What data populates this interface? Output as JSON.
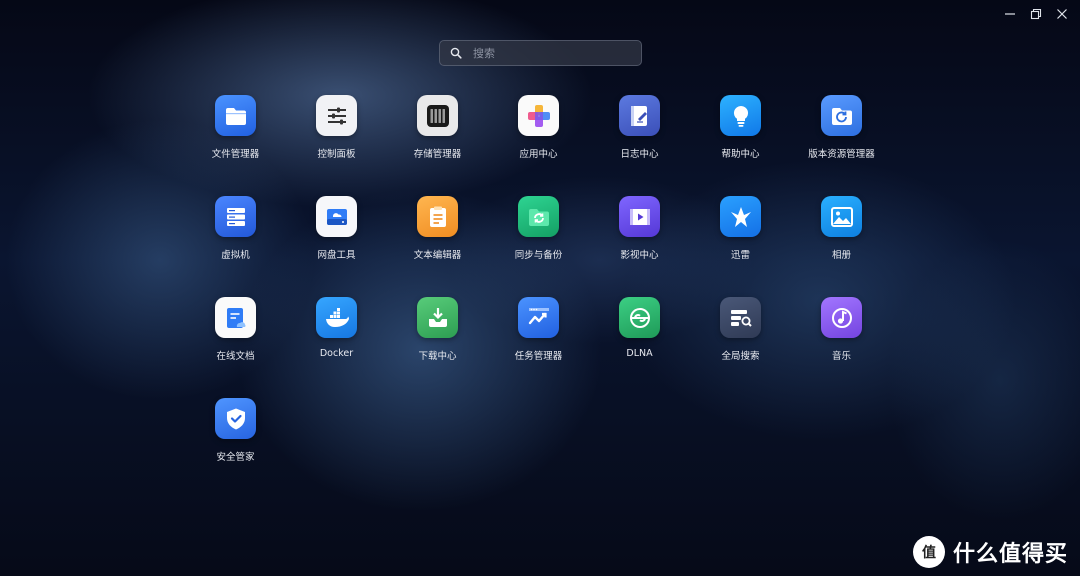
{
  "window": {
    "controls": [
      {
        "name": "minimize-icon"
      },
      {
        "name": "restore-icon"
      },
      {
        "name": "close-icon"
      }
    ]
  },
  "search": {
    "placeholder": "搜索",
    "icon": "search-icon"
  },
  "apps": [
    {
      "label": "文件管理器",
      "icon": "folder-icon",
      "color": "#2f7cf6"
    },
    {
      "label": "控制面板",
      "icon": "sliders-icon",
      "color": "#f2f2f4"
    },
    {
      "label": "存储管理器",
      "icon": "storage-icon",
      "color": "#ececec"
    },
    {
      "label": "应用中心",
      "icon": "apps-icon",
      "color": "#fafafa"
    },
    {
      "label": "日志中心",
      "icon": "log-icon",
      "color": "#4a63c8"
    },
    {
      "label": "帮助中心",
      "icon": "lightbulb-icon",
      "color": "#1a9bf2"
    },
    {
      "label": "版本资源管理器",
      "icon": "version-folder-icon",
      "color": "#3a86ef"
    },
    {
      "label": "虚拟机",
      "icon": "server-icon",
      "color": "#2e6ff0"
    },
    {
      "label": "网盘工具",
      "icon": "cloud-drive-icon",
      "color": "#f7f8fb"
    },
    {
      "label": "文本编辑器",
      "icon": "clipboard-icon",
      "color": "#f5a340"
    },
    {
      "label": "同步与备份",
      "icon": "sync-folder-icon",
      "color": "#1fb87a"
    },
    {
      "label": "影视中心",
      "icon": "video-icon",
      "color": "#6a4ef0"
    },
    {
      "label": "迅雷",
      "icon": "thunder-bird-icon",
      "color": "#1f88f2"
    },
    {
      "label": "相册",
      "icon": "photo-icon",
      "color": "#1898ee"
    },
    {
      "label": "在线文档",
      "icon": "online-doc-icon",
      "color": "#fafafa"
    },
    {
      "label": "Docker",
      "icon": "docker-icon",
      "color": "#1d8ff0"
    },
    {
      "label": "下载中心",
      "icon": "download-icon",
      "color": "#43b866"
    },
    {
      "label": "任务管理器",
      "icon": "task-chart-icon",
      "color": "#2f7cf6"
    },
    {
      "label": "DLNA",
      "icon": "dlna-icon",
      "color": "#2fb56e"
    },
    {
      "label": "全局搜索",
      "icon": "global-search-icon",
      "color": "#3d4a66"
    },
    {
      "label": "音乐",
      "icon": "music-icon",
      "color": "#8e5cf0"
    },
    {
      "label": "安全管家",
      "icon": "shield-check-icon",
      "color": "#3a86f2"
    }
  ],
  "watermark": {
    "text": "什么值得买",
    "icon": "zhi-logo-icon"
  }
}
